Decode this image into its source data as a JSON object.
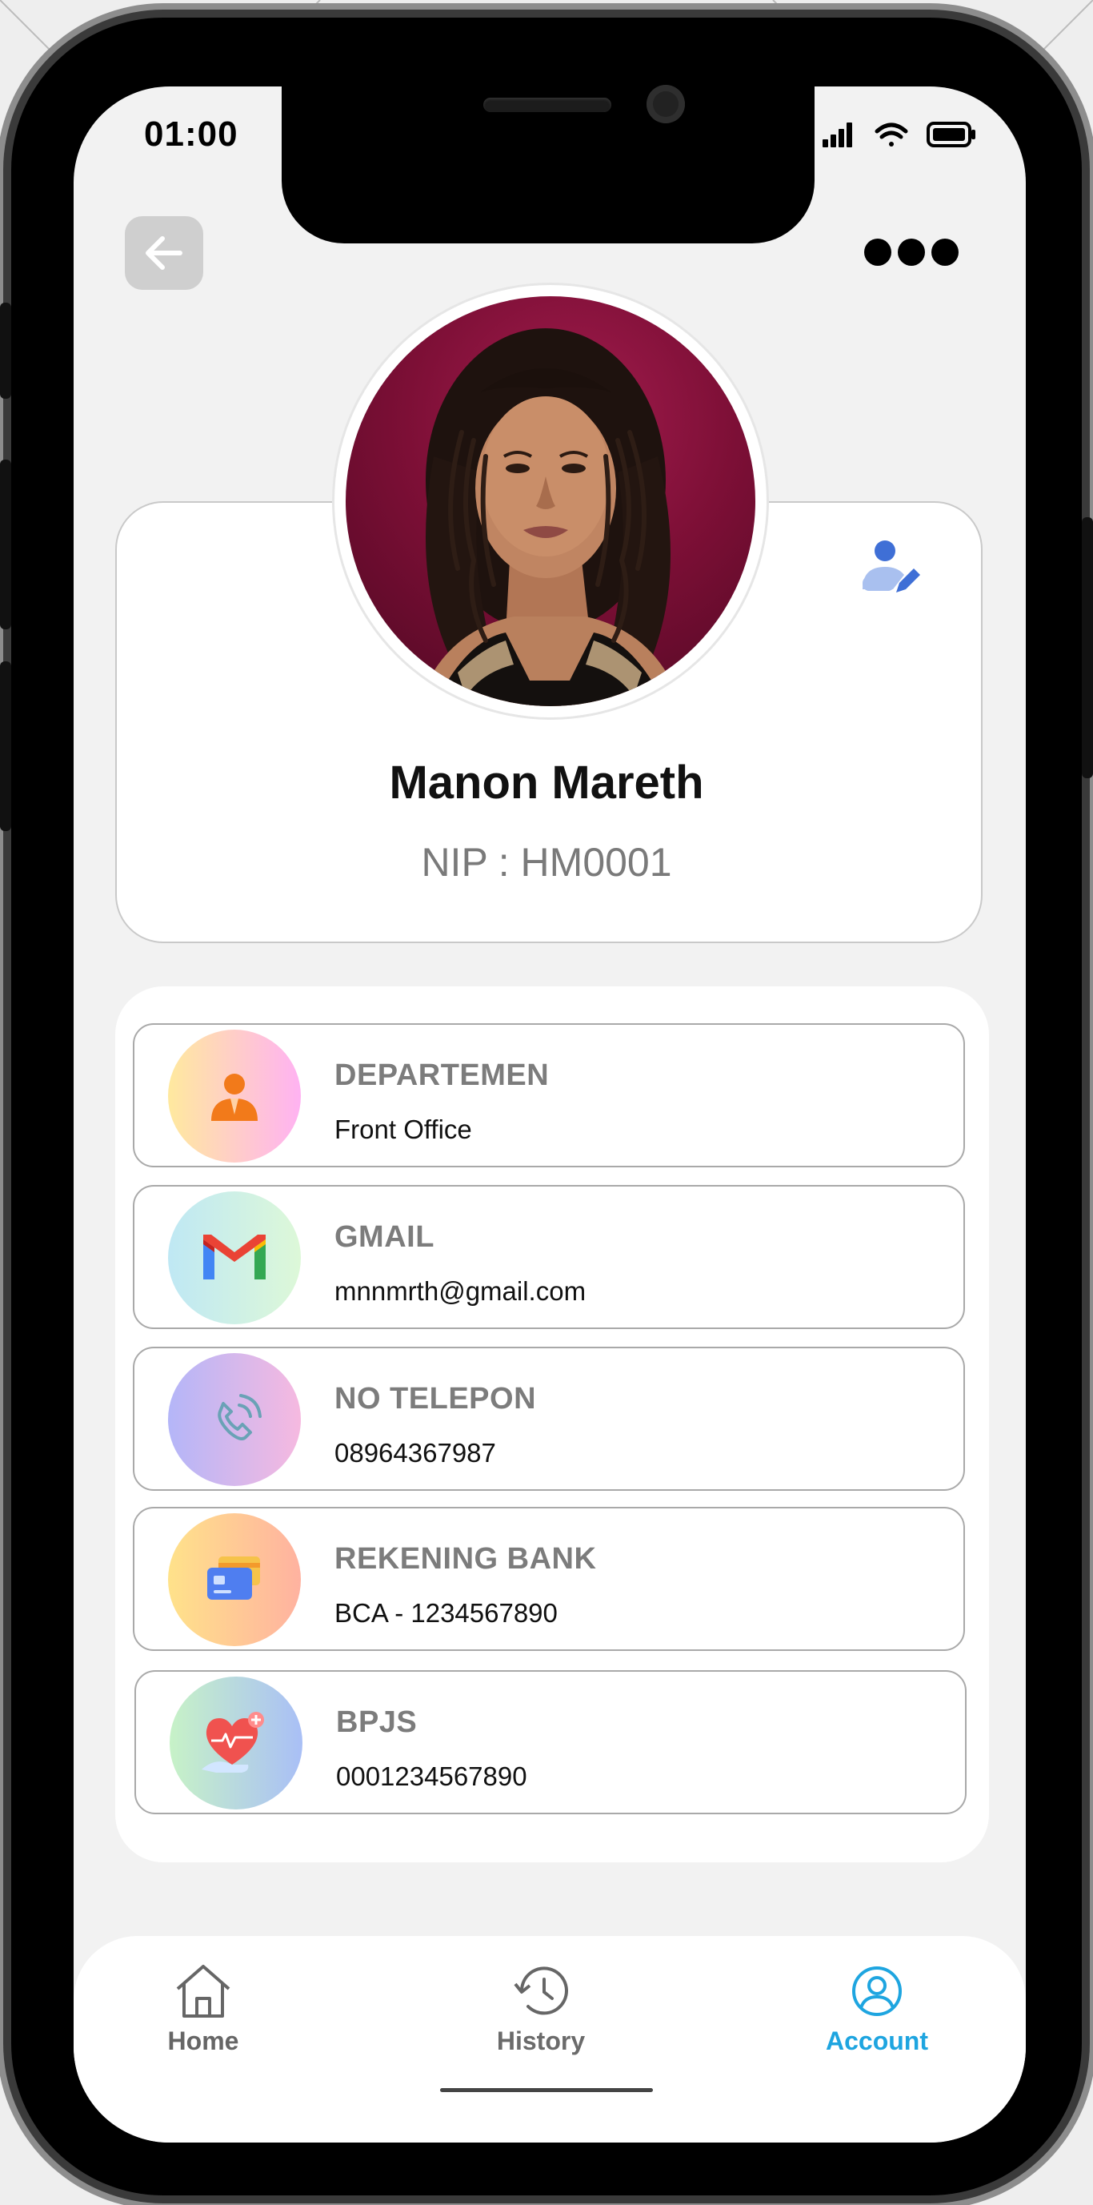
{
  "status_bar": {
    "time": "01:00"
  },
  "header": {
    "back_icon": "arrow-left-icon",
    "more_icon": "more-dots-icon"
  },
  "profile": {
    "name": "Manon Mareth",
    "nip": "NIP : HM0001",
    "edit_icon": "user-edit-icon"
  },
  "info_items": [
    {
      "label": "DEPARTEMEN",
      "value": "Front Office",
      "icon": "employee-icon",
      "gradient": [
        "#ffe7a0",
        "#ffb3f0"
      ]
    },
    {
      "label": "GMAIL",
      "value": "mnnmrth@gmail.com",
      "icon": "gmail-icon",
      "gradient": [
        "#bfe8f4",
        "#ddf8d8"
      ]
    },
    {
      "label": "NO TELEPON",
      "value": "08964367987",
      "icon": "phone-icon",
      "gradient": [
        "#b4b6f8",
        "#f6b9e0"
      ]
    },
    {
      "label": "REKENING BANK",
      "value": "BCA - 1234567890",
      "icon": "bank-card-icon",
      "gradient": [
        "#ffe28a",
        "#ffb2a0"
      ]
    },
    {
      "label": "BPJS",
      "value": "0001234567890",
      "icon": "health-heart-icon",
      "gradient": [
        "#c7f2c7",
        "#a9bff6"
      ]
    }
  ],
  "nav": {
    "items": [
      {
        "label": "Home",
        "icon": "home-icon",
        "color": "#666666"
      },
      {
        "label": "History",
        "icon": "history-icon",
        "color": "#6b6b6b"
      },
      {
        "label": "Account",
        "icon": "account-icon",
        "color": "#1ea5e0"
      }
    ],
    "active": "Account"
  }
}
